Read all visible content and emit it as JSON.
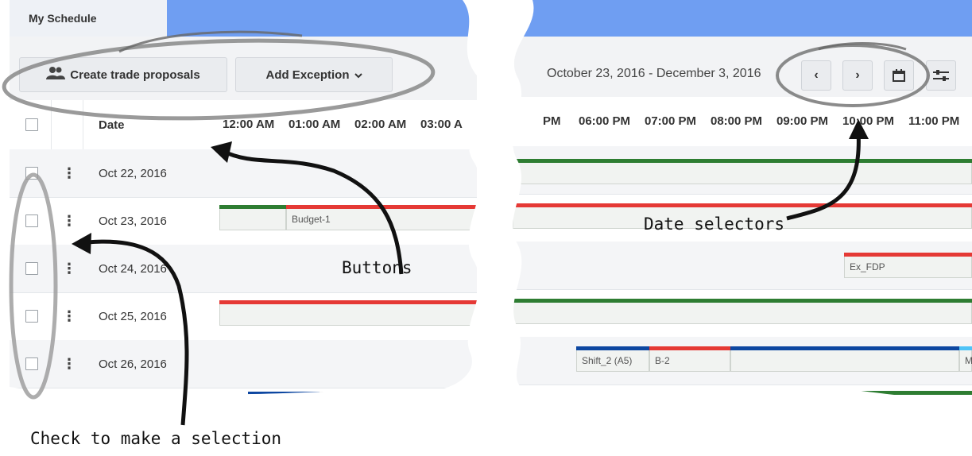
{
  "colors": {
    "accent_tab": "#6f9ef2",
    "green": "#2e7d32",
    "red": "#e53935",
    "blue": "#0d47a1",
    "cyan": "#4fc3f7",
    "gray": "#bdbdbd"
  },
  "left": {
    "tab_label": "My Schedule",
    "buttons": {
      "trade": {
        "icon": "people-icon",
        "label": "Create trade proposals"
      },
      "exception": {
        "label": "Add Exception",
        "icon": "chevron-down-icon"
      }
    },
    "header": {
      "date_label": "Date",
      "hours": [
        "12:00 AM",
        "01:00 AM",
        "02:00 AM",
        "03:00 A"
      ]
    },
    "rows": [
      {
        "date": "Oct 22, 2016"
      },
      {
        "date": "Oct 23, 2016",
        "block_label": "Budget-1"
      },
      {
        "date": "Oct 24, 2016"
      },
      {
        "date": "Oct 25, 2016"
      },
      {
        "date": "Oct 26, 2016"
      }
    ]
  },
  "right": {
    "date_range": "October 23, 2016 - December 3, 2016",
    "nav": {
      "prev_icon": "chevron-left-icon",
      "next_icon": "chevron-right-icon",
      "calendar_icon": "calendar-icon",
      "settings_icon": "sliders-icon"
    },
    "hours": [
      "PM",
      "06:00 PM",
      "07:00 PM",
      "08:00 PM",
      "09:00 PM",
      "10:00 PM",
      "11:00 PM"
    ],
    "rows": [
      {
        "block_label": ""
      },
      {
        "block_label": ""
      },
      {
        "block_label": "Ex_FDP"
      },
      {
        "block_label": ""
      },
      {
        "block_label": "Shift_2 (A5)",
        "block_label_2": "B-2",
        "block_label_3": "M"
      }
    ]
  },
  "annotations": {
    "buttons": "Buttons",
    "date_selectors": "Date selectors",
    "check": "Check to make a selection"
  }
}
